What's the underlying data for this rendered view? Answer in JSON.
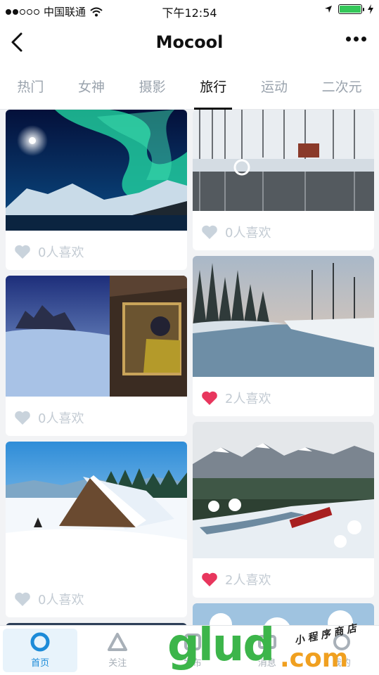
{
  "status": {
    "carrier": "中国联通",
    "time": "下午12:54"
  },
  "nav": {
    "title": "Mocool"
  },
  "tabs": [
    {
      "label": "热门"
    },
    {
      "label": "女神"
    },
    {
      "label": "摄影"
    },
    {
      "label": "旅行",
      "active": true
    },
    {
      "label": "运动"
    },
    {
      "label": "二次元"
    }
  ],
  "cards": {
    "left": [
      {
        "likes": "0人喜欢",
        "liked": false,
        "scene": "aurora"
      },
      {
        "likes": "0人喜欢",
        "liked": false,
        "scene": "cabin-window"
      },
      {
        "likes": "0人喜欢",
        "liked": false,
        "scene": "snow-hut"
      }
    ],
    "right": [
      {
        "likes": "0人喜欢",
        "liked": false,
        "scene": "snowy-lake"
      },
      {
        "likes": "2人喜欢",
        "liked": true,
        "scene": "foggy-river"
      },
      {
        "likes": "2人喜欢",
        "liked": true,
        "scene": "mountain-train"
      }
    ]
  },
  "tabbar": [
    {
      "label": "首页",
      "active": true,
      "icon": "circle-icon"
    },
    {
      "label": "关注",
      "active": false,
      "icon": "triangle-icon"
    },
    {
      "label": "发布",
      "active": false,
      "icon": "publish-icon"
    },
    {
      "label": "消息",
      "active": false,
      "icon": "message-icon"
    },
    {
      "label": "我的",
      "active": false,
      "icon": "profile-icon"
    }
  ],
  "watermark": {
    "brand": "glud",
    "domain": ".com",
    "tagline": "小 程 序 商 店"
  },
  "colors": {
    "accent": "#1d8bd8",
    "heart_active": "#e8365d",
    "heart_idle": "#c9d3dc"
  }
}
